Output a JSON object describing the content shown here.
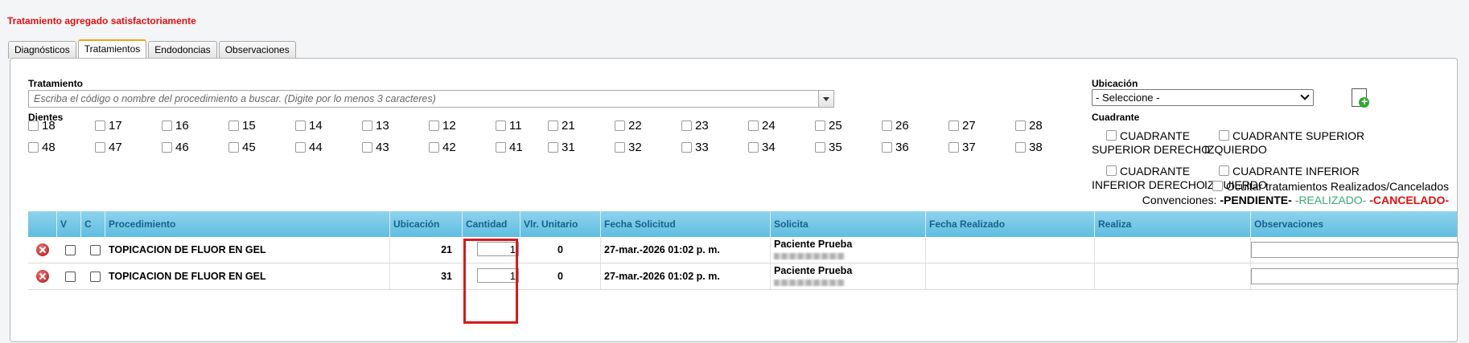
{
  "message": "Tratamiento agregado satisfactoriamente",
  "tabs": [
    "Diagnósticos",
    "Tratamientos",
    "Endodoncias",
    "Observaciones"
  ],
  "form": {
    "tratamiento_label": "Tratamiento",
    "search_placeholder": "Escriba el código o nombre del procedimiento a buscar. (Digite por lo menos 3 caracteres)",
    "dientes_label": "Dientes",
    "ubicacion_label": "Ubicación",
    "ubicacion_value": "- Seleccione -",
    "cuadrante_label": "Cuadrante",
    "teeth_row1": [
      "18",
      "17",
      "16",
      "15",
      "14",
      "13",
      "12",
      "11",
      "21",
      "22",
      "23",
      "24",
      "25",
      "26",
      "27",
      "28"
    ],
    "teeth_row2": [
      "48",
      "47",
      "46",
      "45",
      "44",
      "43",
      "42",
      "41",
      "31",
      "32",
      "33",
      "34",
      "35",
      "36",
      "37",
      "38"
    ],
    "quadrants": [
      {
        "line1": "CUADRANTE",
        "line2": "SUPERIOR DERECHO"
      },
      {
        "line1": "CUADRANTE SUPERIOR",
        "line2": "IZQUIERDO"
      },
      {
        "line1": "CUADRANTE",
        "line2": "INFERIOR DERECHO"
      },
      {
        "line1": "CUADRANTE INFERIOR",
        "line2": "IZQUIERDO"
      }
    ],
    "hide_label": "Ocultar tratamientos Realizados/Cancelados",
    "conv_label": "Convenciones:",
    "conv_pendiente": "-PENDIENTE-",
    "conv_realizado": "-REALIZADO-",
    "conv_cancelado": "-CANCELADO-"
  },
  "colors": {
    "realizado": "#3aa87a",
    "cancelado": "#e01010",
    "header": "#6cc5e6"
  },
  "table": {
    "headers": [
      "V",
      "C",
      "Procedimiento",
      "Ubicación",
      "Cantidad",
      "Vlr. Unitario",
      "Fecha Solicitud",
      "Solicita",
      "Fecha Realizado",
      "Realiza",
      "Observaciones"
    ],
    "rows": [
      {
        "procedimiento": "TOPICACION DE FLUOR EN GEL",
        "ubicacion": "21",
        "cantidad": "1",
        "vlr": "0",
        "fecha": "27-mar.-2026 01:02 p. m.",
        "solicita": "Paciente Prueba"
      },
      {
        "procedimiento": "TOPICACION DE FLUOR EN GEL",
        "ubicacion": "31",
        "cantidad": "1",
        "vlr": "0",
        "fecha": "27-mar.-2026 01:02 p. m.",
        "solicita": "Paciente Prueba"
      }
    ]
  }
}
